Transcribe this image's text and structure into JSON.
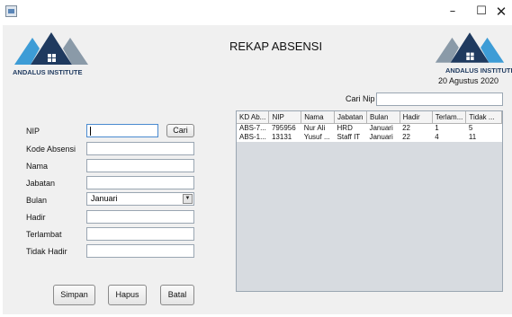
{
  "window": {
    "controls": {
      "minimize": "–",
      "maximize": "☐",
      "close": "✕"
    }
  },
  "header": {
    "logo_text": "ANDALUS INSTITUTE",
    "title": "REKAP ABSENSI",
    "date": "20 Agustus 2020",
    "brand_color": "#1f3a5f",
    "accent_color": "#3d9cd6"
  },
  "search": {
    "label": "Cari Nip",
    "value": ""
  },
  "form": {
    "nip": {
      "label": "NIP",
      "value": ""
    },
    "cari_button": "Cari",
    "kode_absensi": {
      "label": "Kode Absensi",
      "value": ""
    },
    "nama": {
      "label": "Nama",
      "value": ""
    },
    "jabatan": {
      "label": "Jabatan",
      "value": ""
    },
    "bulan": {
      "label": "Bulan",
      "selected": "Januari"
    },
    "hadir": {
      "label": "Hadir",
      "value": ""
    },
    "terlambat": {
      "label": "Terlambat",
      "value": ""
    },
    "tidak_hadir": {
      "label": "Tidak Hadir",
      "value": ""
    }
  },
  "buttons": {
    "simpan": "Simpan",
    "hapus": "Hapus",
    "batal": "Batal"
  },
  "table": {
    "headers": [
      "KD Ab...",
      "NIP",
      "Nama",
      "Jabatan",
      "Bulan",
      "Hadir",
      "Terlam...",
      "Tidak ..."
    ],
    "rows": [
      [
        "ABS-7...",
        "795956",
        "Nur Ali",
        "HRD",
        "Januari",
        "22",
        "1",
        "5"
      ],
      [
        "ABS-1...",
        "13131",
        "Yusuf ...",
        "Staff IT",
        "Januari",
        "22",
        "4",
        "11"
      ]
    ]
  }
}
